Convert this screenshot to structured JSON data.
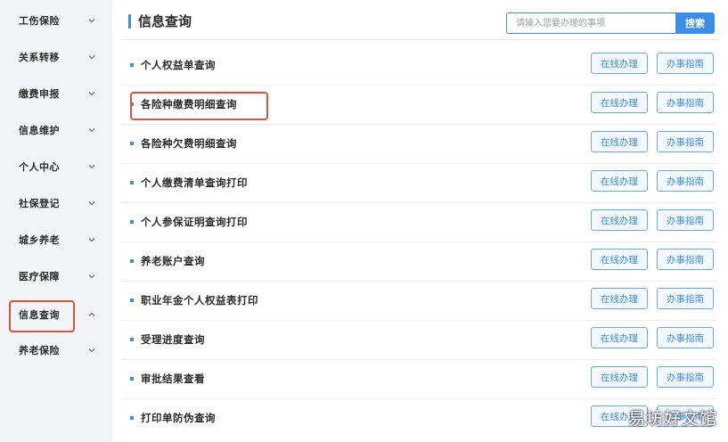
{
  "sidebar": {
    "items": [
      {
        "label": "工伤保险",
        "expanded": false
      },
      {
        "label": "关系转移",
        "expanded": false
      },
      {
        "label": "缴费申报",
        "expanded": false
      },
      {
        "label": "信息维护",
        "expanded": false
      },
      {
        "label": "个人中心",
        "expanded": false
      },
      {
        "label": "社保登记",
        "expanded": false
      },
      {
        "label": "城乡养老",
        "expanded": false
      },
      {
        "label": "医疗保障",
        "expanded": false
      },
      {
        "label": "信息查询",
        "expanded": true
      },
      {
        "label": "养老保险",
        "expanded": false
      }
    ]
  },
  "main": {
    "title": "信息查询",
    "search": {
      "placeholder": "请输入您要办理的事项",
      "button_label": "搜索"
    },
    "rows": [
      {
        "label": "个人权益单查询",
        "online_label": "在线办理",
        "guide_label": "办事指南"
      },
      {
        "label": "各险种缴费明细查询",
        "online_label": "在线办理",
        "guide_label": "办事指南"
      },
      {
        "label": "各险种欠费明细查询",
        "online_label": "在线办理",
        "guide_label": "办事指南"
      },
      {
        "label": "个人缴费清单查询打印",
        "online_label": "在线办理",
        "guide_label": "办事指南"
      },
      {
        "label": "个人参保证明查询打印",
        "online_label": "在线办理",
        "guide_label": "办事指南"
      },
      {
        "label": "养老账户查询",
        "online_label": "在线办理",
        "guide_label": "办事指南"
      },
      {
        "label": "职业年金个人权益表打印",
        "online_label": "在线办理",
        "guide_label": "办事指南"
      },
      {
        "label": "受理进度查询",
        "online_label": "在线办理",
        "guide_label": "办事指南"
      },
      {
        "label": "审批结果查看",
        "online_label": "在线办理",
        "guide_label": "办事指南"
      },
      {
        "label": "打印单防伪查询",
        "online_label": "在线办理",
        "guide_label": "办事指南"
      }
    ]
  },
  "watermark": "易坊好文馆",
  "colors": {
    "accent": "#3d8ee8",
    "highlight": "#e0533b"
  }
}
